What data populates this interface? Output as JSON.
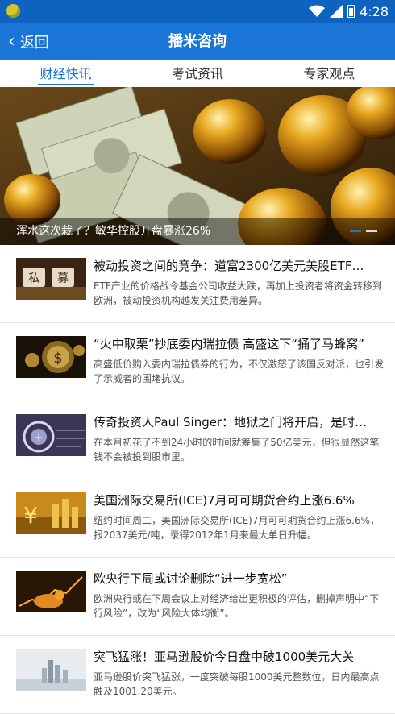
{
  "status": {
    "time": "4:28"
  },
  "header": {
    "back_label": "返回",
    "title": "播米咨询"
  },
  "tabs": [
    {
      "label": "财经快讯",
      "active": true
    },
    {
      "label": "考试资讯",
      "active": false
    },
    {
      "label": "专家观点",
      "active": false
    }
  ],
  "banner": {
    "caption": "浑水这次栽了？敏华控股开盘暴涨26%",
    "slides": 2,
    "current": 1
  },
  "news": [
    {
      "title": "被动投资之间的竞争：道富2300亿美元美股ETF…",
      "desc": "ETF产业的价格战令基金公司收益大跌，再加上投资者将资金转移到欧洲，被动投资机构越发关注费用差异。",
      "thumb_icon": "private-equity-thumb"
    },
    {
      "title": "“火中取栗”抄底委内瑞拉债 高盛这下“捅了马蜂窝”",
      "desc": "高盛低价购入委内瑞拉债券的行为，不仅激怒了该国反对派，也引发了示威者的围堵抗议。",
      "thumb_icon": "gold-dollar-thumb"
    },
    {
      "title": "传奇投资人Paul Singer：地狱之门将开启，是时…",
      "desc": "在本月初花了不到24小时的时间就筹集了50亿美元，但很显然这笔钱不会被投到股市里。",
      "thumb_icon": "globe-target-thumb"
    },
    {
      "title": "美国洲际交易所(ICE)7月可可期货合约上涨6.6%",
      "desc": "纽约时间周二，美国洲际交易所(ICE)7月可可期货合约上涨6.6%，报2037美元/吨，录得2012年1月来最大单日升幅。",
      "thumb_icon": "yen-gold-thumb"
    },
    {
      "title": "欧央行下周或讨论删除“进一步宽松”",
      "desc": "欧洲央行或在下周会议上对经济给出更积极的评估，删掉声明中“下行风险”，改为“风险大体均衡”。",
      "thumb_icon": "bull-market-thumb"
    },
    {
      "title": "突飞猛涨！亚马逊股价今日盘中破1000美元大关",
      "desc": "亚马逊股价突飞猛涨，一度突破每股1000美元整数位，日内最高点触及1001.20美元。",
      "thumb_icon": "city-skyline-thumb"
    }
  ],
  "colors": {
    "primary": "#1a75d6",
    "statusbar": "#0f63c0"
  }
}
